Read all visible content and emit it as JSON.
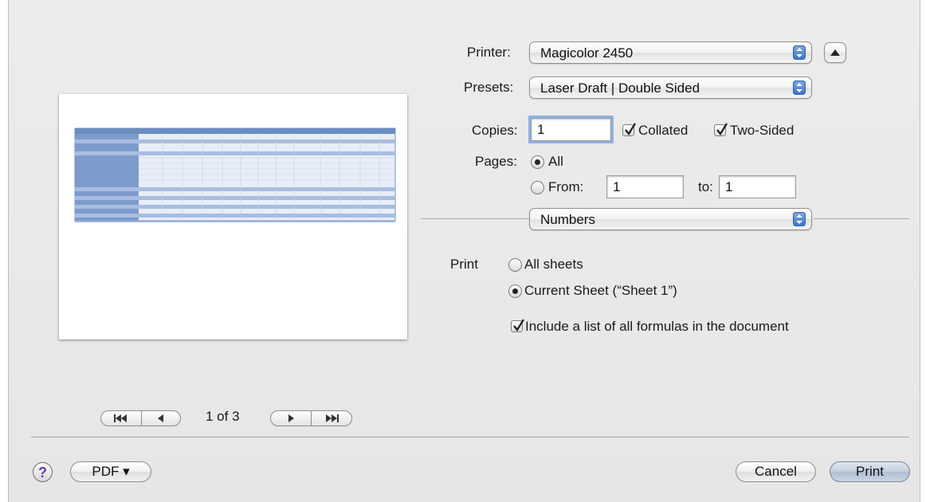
{
  "printer": {
    "label": "Printer:",
    "value": "Magicolor 2450",
    "disclosure_icon": "triangle-up-icon"
  },
  "presets": {
    "label": "Presets:",
    "value": "Laser Draft | Double Sided"
  },
  "copies": {
    "label": "Copies:",
    "value": "1",
    "collated_label": "Collated",
    "collated_checked": true,
    "two_sided_label": "Two-Sided",
    "two_sided_checked": true
  },
  "pages": {
    "label": "Pages:",
    "all_label": "All",
    "all_selected": true,
    "from_label": "From:",
    "from_value": "1",
    "to_label": "to:",
    "to_value": "1"
  },
  "panel": {
    "value": "Numbers"
  },
  "print_options": {
    "label": "Print",
    "all_sheets_label": "All sheets",
    "all_sheets_selected": false,
    "current_sheet_label": "Current Sheet (“Sheet 1”)",
    "current_sheet_selected": true,
    "formulas_label": "Include a list of all formulas in the document",
    "formulas_checked": true
  },
  "preview": {
    "page_indicator": "1 of 3",
    "first_icon": "first-page-icon",
    "prev_icon": "previous-page-icon",
    "next_icon": "next-page-icon",
    "last_icon": "last-page-icon"
  },
  "footer": {
    "help_label": "?",
    "pdf_label": "PDF ▾",
    "cancel_label": "Cancel",
    "print_label": "Print"
  },
  "colors": {
    "accent": "#3b73c8",
    "header_band": "#6a8cc0",
    "sheet_bg": "#e9e9e9"
  }
}
